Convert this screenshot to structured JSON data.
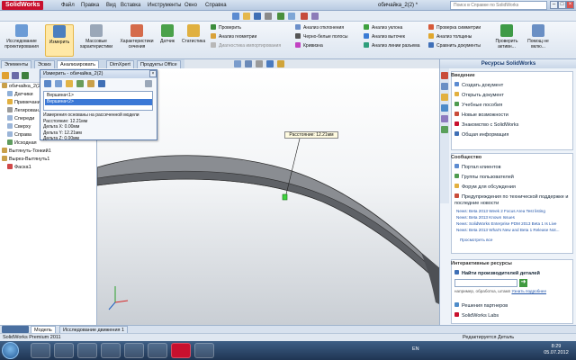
{
  "app": {
    "logo": "SolidWorks",
    "doc_title": "обичайка_2(2) *",
    "help_placeholder": "Поиск в Справке по SolidWorks"
  },
  "menu": [
    "Файл",
    "Правка",
    "Вид",
    "Вставка",
    "Инструменты",
    "Окно",
    "Справка"
  ],
  "ribbon": {
    "big_buttons": [
      "Исследование проектирования",
      "Измерить",
      "Массовые характеристики",
      "Характеристики сечения",
      "Датчик",
      "Статистика"
    ],
    "col1": [
      "Проверить",
      "Анализ геометрии",
      "Диагностика импортирования"
    ],
    "col2": [
      "Анализ отклонения",
      "Черно-белые полосы",
      "Кривизна"
    ],
    "col3": [
      "Анализ уклона",
      "Анализ выточек",
      "Анализ линии разъема"
    ],
    "col4": [
      "Проверка симметрии",
      "Анализ толщины",
      "Сравнить документы"
    ],
    "big_right": [
      "Проверить активн...",
      "Помощ не вклю..."
    ]
  },
  "cmd_tabs": [
    "Элементы",
    "Эскиз",
    "Анализировать",
    "DimXpert",
    "Продукты Office"
  ],
  "tree": [
    {
      "label": "обичайка_2(2)",
      "indent": 0
    },
    {
      "label": "Датчики",
      "indent": 1
    },
    {
      "label": "Примечания",
      "indent": 1
    },
    {
      "label": "Легирован...",
      "indent": 1
    },
    {
      "label": "Спереди",
      "indent": 1
    },
    {
      "label": "Сверху",
      "indent": 1
    },
    {
      "label": "Справа",
      "indent": 1
    },
    {
      "label": "Исходная",
      "indent": 1
    },
    {
      "label": "Вытянуть-Тонкий1",
      "indent": 0
    },
    {
      "label": "Вырез-Вытянуть1",
      "indent": 0
    },
    {
      "label": "Фаска1",
      "indent": 1
    }
  ],
  "measure": {
    "title": "Измерить - обичайка_2(2)",
    "items": [
      "Вершина<1>",
      "Вершина<2>"
    ],
    "result": [
      "Измерения основаны на рассеченной модели",
      "Расстояние: 12.21мм",
      "Дельта X: 0.00мм",
      "Дельта Y: 12.21мм",
      "Дельта Z: 0.00мм"
    ]
  },
  "callout": "Расстояние: 12.21мм",
  "taskpane": {
    "title": "Ресурсы SolidWorks",
    "intro_heading": "Введение",
    "intro": [
      "Создать документ",
      "Открыть документ",
      "Учебные пособия",
      "Новые возможности",
      "Знакомство с SolidWorks",
      "Общая информация"
    ],
    "community_heading": "Сообщество",
    "community": [
      "Портал клиентов",
      "Группы пользователей",
      "Форум для обсуждения",
      "Предупреждения по технической поддержке и последние новости"
    ],
    "news": [
      "News: Beta 2013 Week 2 Focus Area Test listing",
      "News: Beta 2013 Known Issues",
      "News: SolidWorks Enterprise PDM 2013 Beta 1 Is Live",
      "News: Beta 2013 What's New and Beta 1 Release Not...",
      "Просмотреть все"
    ],
    "online_heading": "Интерактивные ресурсы",
    "online_label": "Найти производителей деталей",
    "online_hint": "например, обработка, штамп",
    "online_hint_link": "Узнать подробнее",
    "partners": "Решения партнеров",
    "labs": "SolidWorks Labs"
  },
  "bottom_tabs": [
    "Модель",
    "Исследование движения 1"
  ],
  "status": {
    "left": "SolidWorks Premium 2011",
    "right": "Редактируется Деталь"
  },
  "taskbar": {
    "lang": "EN",
    "time": "8:29",
    "date": "05.07.2012"
  },
  "colors": {
    "accent": "#1c3e72",
    "selection": "#3b78d6",
    "logo": "#c8102e"
  }
}
